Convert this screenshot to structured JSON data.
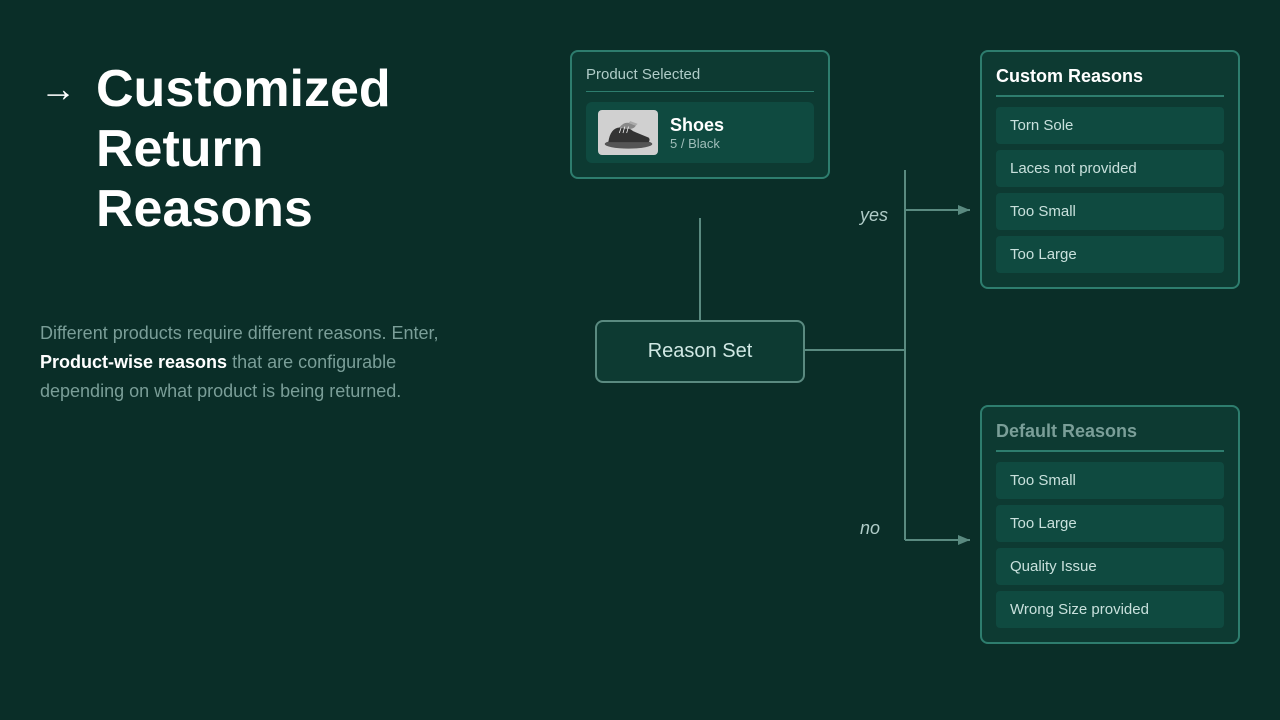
{
  "header": {
    "arrow": "→",
    "title_line1": "Customized",
    "title_line2": "Return",
    "title_line3": "Reasons"
  },
  "description": {
    "text_before": "Different products require different reasons. Enter,",
    "bold_text": "Product-wise reasons",
    "text_after": " that are configurable depending on what product is being returned."
  },
  "product_selected": {
    "label": "Product Selected",
    "product_name": "Shoes",
    "product_variant": "5 / Black"
  },
  "reason_set": {
    "label": "Reason Set"
  },
  "custom_reasons": {
    "label": "Custom Reasons",
    "items": [
      {
        "text": "Torn Sole"
      },
      {
        "text": "Laces not provided"
      },
      {
        "text": "Too Small"
      },
      {
        "text": "Too Large"
      }
    ]
  },
  "default_reasons": {
    "label": "Default Reasons",
    "items": [
      {
        "text": "Too Small"
      },
      {
        "text": "Too Large"
      },
      {
        "text": "Quality Issue"
      },
      {
        "text": "Wrong Size provided"
      }
    ]
  },
  "connectors": {
    "yes_label": "yes",
    "no_label": "no"
  }
}
